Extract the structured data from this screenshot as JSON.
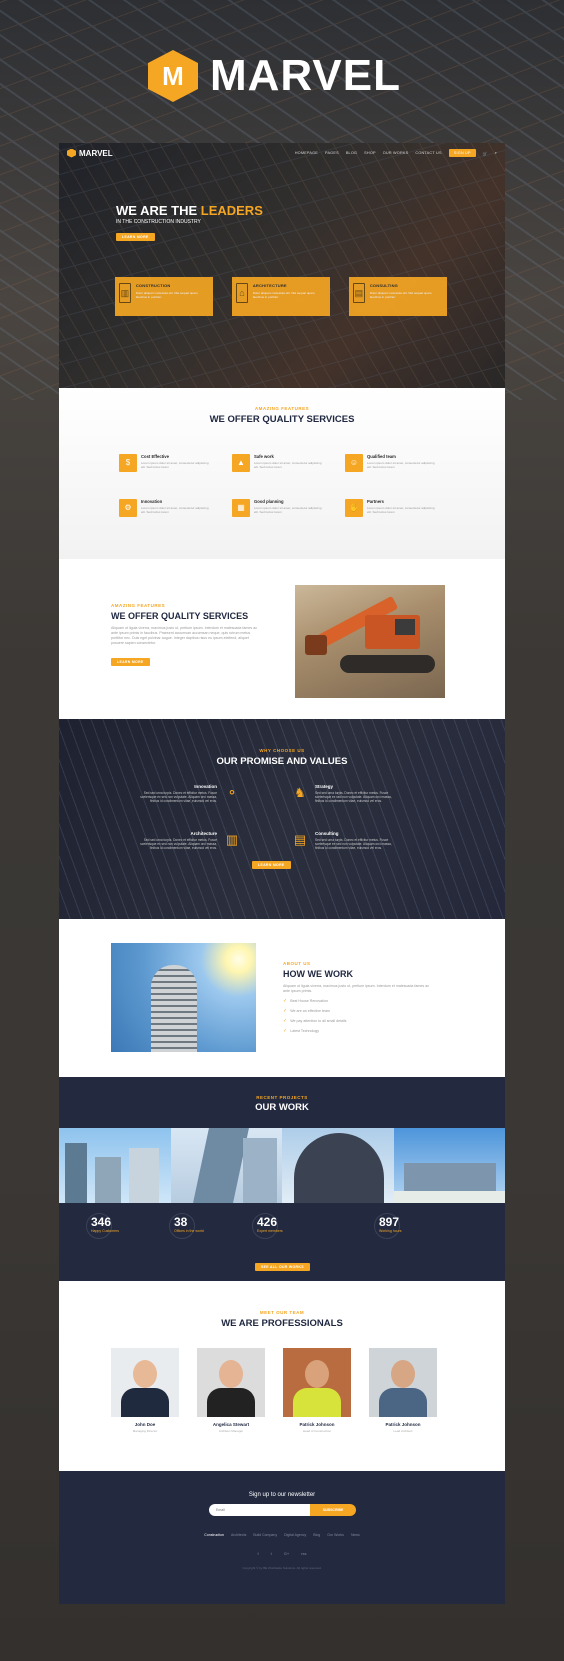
{
  "brand": {
    "name": "MARVEL",
    "logo_letter": "M"
  },
  "nav": {
    "logo": "MARVEL",
    "items": [
      "HOMEPAGE",
      "PAGES",
      "BLOG",
      "SHOP",
      "OUR WORKS",
      "CONTACT US"
    ],
    "signup": "SIGN UP"
  },
  "hero": {
    "title_pre": "WE ARE THE ",
    "title_accent": "LEADERS",
    "subtitle": "IN THE CONSTRUCTION INDUSTRY",
    "button": "LEARN MORE",
    "cards": [
      {
        "title": "CONSTRUCTION",
        "icon": "building-icon",
        "text": "Dolor aliquam molestias elit. Nisi sequat quam, faucibus in porttitor."
      },
      {
        "title": "ARCHITECTURE",
        "icon": "blueprint-icon",
        "text": "Dolor aliquam molestias elit. Nisi sequat quam, faucibus in porttitor."
      },
      {
        "title": "CONSULTING",
        "icon": "document-icon",
        "text": "Dolor aliquam molestias elit. Nisi sequat quam, faucibus in porttitor."
      }
    ]
  },
  "features": {
    "kicker": "AMAZING FEATURES",
    "title": "WE OFFER QUALITY SERVICES",
    "items": [
      {
        "title": "Cost Effective",
        "text": "Lorem ipsum dolor sit amet, consectetur adipiscing elit. Sed luctus lorem"
      },
      {
        "title": "Safe work",
        "text": "Lorem ipsum dolor sit amet, consectetur adipiscing elit. Sed luctus lorem"
      },
      {
        "title": "Qualified team",
        "text": "Lorem ipsum dolor sit amet, consectetur adipiscing elit. Sed luctus lorem"
      },
      {
        "title": "Innovation",
        "text": "Lorem ipsum dolor sit amet, consectetur adipiscing elit. Sed luctus lorem"
      },
      {
        "title": "Good planning",
        "text": "Lorem ipsum dolor sit amet, consectetur adipiscing elit. Sed luctus lorem"
      },
      {
        "title": "Partners",
        "text": "Lorem ipsum dolor sit amet, consectetur adipiscing elit. Sed luctus lorem"
      }
    ]
  },
  "quality": {
    "kicker": "AMAZING FEATURES",
    "title": "WE OFFER QUALITY SERVICES",
    "body": "Aliquam ut ligula viverra, maximus justo ut, pretium ipsum. Interdum et malesuada fames ac ante ipsum primis in faucibus. Praesent accumsan accumsan neque, quis rutrum metus porttitor nec. Duis eget pulvinar augue. Integer dapibus risus eu ipsum eleifend, aliquet posuere sapien consectetur.",
    "button": "LEARN MORE"
  },
  "promise": {
    "kicker": "WHY CHOOSE US",
    "title": "OUR PROMISE AND VALUES",
    "items": [
      {
        "title": "Innovation",
        "text": "Sed sed urna turpis. Donec et efficitur metus. Fusce scelerisque ex sed non vulputate. Aliquam orci massa, finibus id condimentum vitae, euismod vel eros."
      },
      {
        "title": "Strategy",
        "text": "Sed sed urna turpis. Donec et efficitur metus. Fusce scelerisque ex sed non vulputate. Aliquam orci massa, finibus id condimentum vitae, euismod vel eros."
      },
      {
        "title": "Architecture",
        "text": "Sed sed urna turpis. Donec et efficitur metus. Fusce scelerisque ex sed non vulputate. Aliquam orci massa, finibus id condimentum vitae, euismod vel eros."
      },
      {
        "title": "Consulting",
        "text": "Sed sed urna turpis. Donec et efficitur metus. Fusce scelerisque ex sed non vulputate. Aliquam orci massa, finibus id condimentum vitae, euismod vel eros."
      }
    ],
    "button": "LEARN MORE"
  },
  "about": {
    "kicker": "ABOUT US",
    "title": "HOW WE WORK",
    "body": "Aliquam ut ligula viverra, maximus justo ut, pretium ipsum. Interdum et malesuada fames ac ante ipsum primis.",
    "list": [
      "Best House Renovation",
      "We are an effective team",
      "We pay attention to all small details",
      "Latest Technology"
    ]
  },
  "work": {
    "kicker": "RECENT PROJECTS",
    "title": "OUR WORK"
  },
  "stats": {
    "items": [
      {
        "number": "346",
        "label": "Happy Customers"
      },
      {
        "number": "38",
        "label": "Offices in the world"
      },
      {
        "number": "426",
        "label": "Expert members"
      },
      {
        "number": "897",
        "label": "Working hours"
      }
    ],
    "button": "SEE ALL OUR WORKS"
  },
  "team": {
    "kicker": "MEET OUR TEAM",
    "title": "WE ARE PROFESSIONALS",
    "members": [
      {
        "name": "John Doe",
        "role": "Managing Director"
      },
      {
        "name": "Angelica Stewart",
        "role": "Architect Manager"
      },
      {
        "name": "Patrick Johnson",
        "role": "Head of Construction"
      },
      {
        "name": "Patrick Johnson",
        "role": "Lead Architect"
      }
    ]
  },
  "footer": {
    "newsletter_title": "Sign up to our newsletter",
    "email_placeholder": "Email",
    "subscribe": "SUBSCRIBE",
    "links": [
      "Construction",
      "Architects",
      "Build Company",
      "Digital Agency",
      "Blog",
      "Our Works",
      "News"
    ],
    "social": [
      "f",
      "t",
      "G+",
      "rss"
    ],
    "copyright": "Copyright © by BE Worldwide Solutions. All rights reserved."
  },
  "colors": {
    "accent": "#f5a623",
    "navy": "#232a40",
    "dark": "#1f2740"
  }
}
